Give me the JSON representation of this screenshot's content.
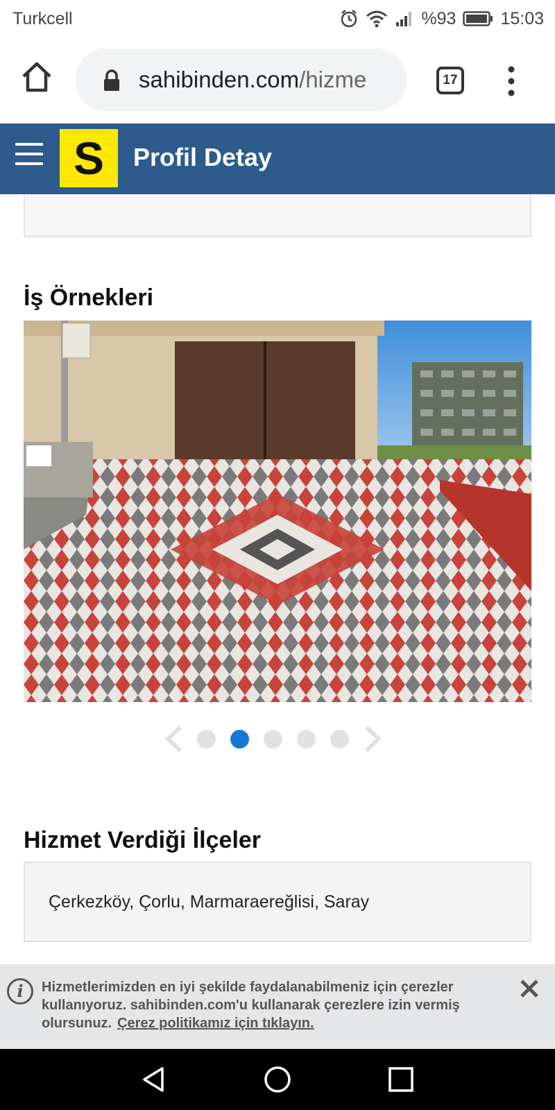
{
  "status_bar": {
    "carrier": "Turkcell",
    "battery": "%93",
    "time": "15:03",
    "icons": [
      "alarm-icon",
      "wifi-icon",
      "signal-icon",
      "battery-icon"
    ]
  },
  "browser": {
    "url_domain": "sahibinden.com",
    "url_path": "/hizme",
    "tab_count": "17",
    "icons": [
      "home-icon",
      "lock-icon",
      "more-vert-icon"
    ]
  },
  "header": {
    "logo_letter": "S",
    "title": "Profil Detay",
    "colors": {
      "bar": "#2c5b8c",
      "logo": "#ffe800"
    }
  },
  "works": {
    "title": "İş Örnekleri",
    "pager": {
      "total": 5,
      "active_index": 2
    }
  },
  "districts": {
    "title": "Hizmet Verdiği İlçeler",
    "list": "Çerkezköy,  Çorlu,  Marmaraereğlisi,  Saray"
  },
  "cookie": {
    "text": "Hizmetlerimizden en iyi şekilde faydalanabilmeniz için çerezler kullanıyoruz. sahibinden.com'u kullanarak çerezlere izin vermiş olursunuz.",
    "link": "Çerez politikamız için tıklayın."
  },
  "navigation": [
    "back-icon",
    "home-circle-icon",
    "recents-icon"
  ]
}
